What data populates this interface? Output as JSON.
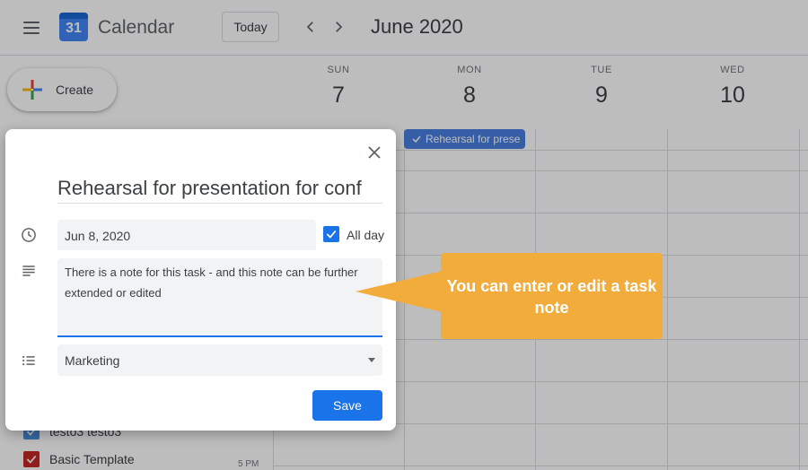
{
  "header": {
    "app_title": "Calendar",
    "logo_day": "31",
    "today_label": "Today",
    "month_title": "June 2020"
  },
  "create": {
    "label": "Create"
  },
  "days": [
    {
      "dow": "SUN",
      "num": "7"
    },
    {
      "dow": "MON",
      "num": "8"
    },
    {
      "dow": "TUE",
      "num": "9"
    },
    {
      "dow": "WED",
      "num": "10"
    }
  ],
  "event_chip": {
    "label": "Rehearsal for prese"
  },
  "sidebar_lists": [
    {
      "label": "testo3 testo3",
      "color": "#4a90d9"
    },
    {
      "label": "Basic Template",
      "color": "#c62828"
    }
  ],
  "time_label": "5 PM",
  "dialog": {
    "title": "Rehearsal for presentation for conf",
    "date": "Jun 8, 2020",
    "allday_label": "All day",
    "allday_checked": true,
    "note": "There is a note for this task - and this note can be further extended or edited",
    "list_value": "Marketing",
    "save_label": "Save"
  },
  "callout": {
    "text": "You can enter or edit a task note",
    "color": "#f2ac3c"
  },
  "colors": {
    "primary": "#1a73e8",
    "event": "#4a7fe0"
  }
}
